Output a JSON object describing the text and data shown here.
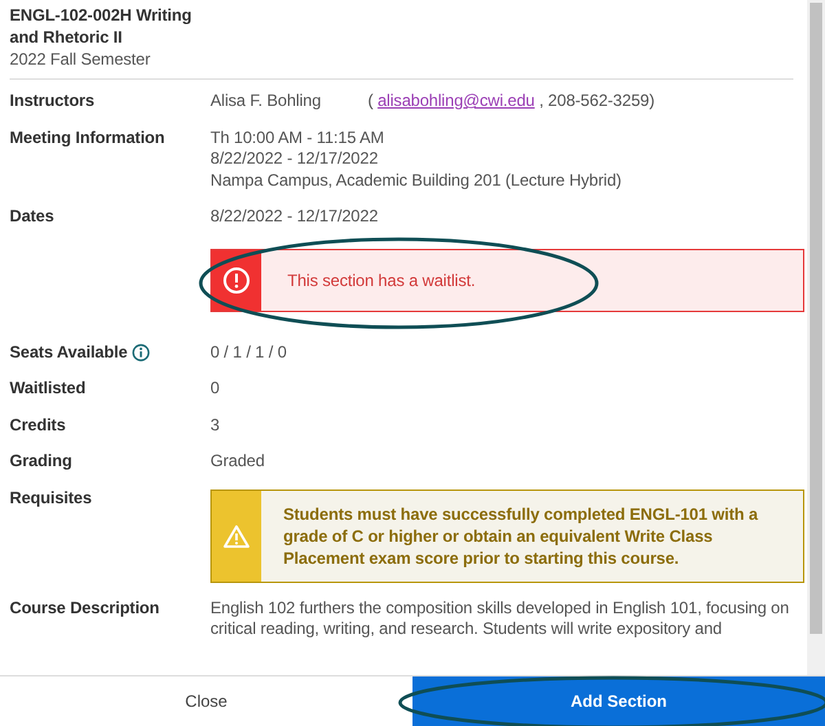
{
  "course": {
    "title": "ENGL-102-002H Writing and Rhetoric II",
    "term": "2022 Fall Semester"
  },
  "details": [
    {
      "kind": "instructor",
      "label": "Instructors",
      "name": "Alisa F. Bohling",
      "email_prefix": "(",
      "email": "alisabohling@cwi.edu",
      "email_suffix": ", 208-562-3259)"
    },
    {
      "kind": "lines",
      "label": "Meeting Information",
      "lines": [
        "Th 10:00 AM - 11:15 AM",
        "8/22/2022 - 12/17/2022",
        "Nampa Campus, Academic Building 201 (Lecture Hybrid)"
      ]
    },
    {
      "kind": "lines",
      "label": "Dates",
      "lines": [
        "8/22/2022 - 12/17/2022"
      ]
    },
    {
      "kind": "error_alert",
      "text": "This section has a waitlist."
    },
    {
      "kind": "lines",
      "label": "Seats Available",
      "info": true,
      "lines": [
        "0 / 1 / 1 / 0"
      ]
    },
    {
      "kind": "lines",
      "label": "Waitlisted",
      "lines": [
        "0"
      ]
    },
    {
      "kind": "lines",
      "label": "Credits",
      "lines": [
        "3"
      ]
    },
    {
      "kind": "lines",
      "label": "Grading",
      "lines": [
        "Graded"
      ]
    },
    {
      "kind": "warning_alert",
      "label": "Requisites",
      "text": "Students must have successfully completed ENGL-101 with a grade of C or higher or obtain an equivalent Write Class Placement exam score prior to starting this course."
    },
    {
      "kind": "lines",
      "label": "Course Description",
      "lines": [
        "English 102 furthers the composition skills developed in English 101, focusing on",
        "critical reading, writing, and research. Students will write expository and"
      ]
    }
  ],
  "buttons": [
    {
      "label": "Close",
      "primary": false
    },
    {
      "label": "Add Section",
      "primary": true
    }
  ]
}
